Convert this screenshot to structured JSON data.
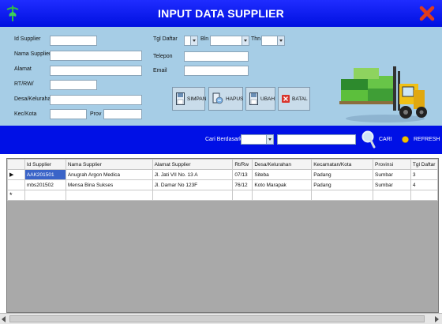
{
  "window": {
    "title": "INPUT DATA SUPPLIER"
  },
  "form": {
    "labels": {
      "id_supplier": "Id Supplier",
      "nama_supplier": "Nama Supplier",
      "alamat": "Alamat",
      "rt_rw": "RT/RW/",
      "desa_kelurahan": "Desa/Kelurahan",
      "kec_kota": "Kec/Kota",
      "prov": "Prov",
      "tgl_daftar": "Tgl Daftar",
      "bln": "Bln",
      "thn": "Thn",
      "telepon": "Telepon",
      "email": "Email"
    },
    "values": {
      "id_supplier": "",
      "nama_supplier": "",
      "alamat": "",
      "rt_rw": "",
      "desa_kelurahan": "",
      "kec_kota": "",
      "prov": "",
      "tgl": "",
      "bln": "",
      "thn": "",
      "telepon": "",
      "email": ""
    }
  },
  "buttons": {
    "simpan": "SIMPAN",
    "hapus": "HAPUS",
    "ubah": "UBAH",
    "batal": "BATAL"
  },
  "search": {
    "label": "Cari Berdasarkan",
    "field": "",
    "keyword": "",
    "cari": "CARI",
    "refresh": "REFRESH"
  },
  "table": {
    "columns": [
      "Id Supplier",
      "Nama Supplier",
      "Alamat Supplier",
      "Rt/Rw",
      "Desa/Kelurahan",
      "Kecamatan/Kota",
      "Provinsi",
      "Tgl Daftar"
    ],
    "rows": [
      [
        "AAK201501",
        "Anugrah Argon Medica",
        "Jl. Jati VII No. 13 A",
        "07/13",
        "Siteba",
        "Padang",
        "Sumbar",
        "3"
      ],
      [
        "mbs201502",
        "Mensa Bina Sukses",
        "Jl. Damar No 123F",
        "76/12",
        "Koto Marapak",
        "Padang",
        "Sumbar",
        "4"
      ]
    ]
  },
  "colors": {
    "title_bar": "#0010e6",
    "form_panel": "#a6cde6",
    "selected_cell": "#3a64c8",
    "close": "#e03c1c"
  },
  "icons": [
    "app-logo-icon",
    "close-icon",
    "save-disk-icon",
    "delete-icon",
    "edit-disk-icon",
    "cancel-icon",
    "magnifier-icon",
    "refresh-icon",
    "forklift-image"
  ]
}
